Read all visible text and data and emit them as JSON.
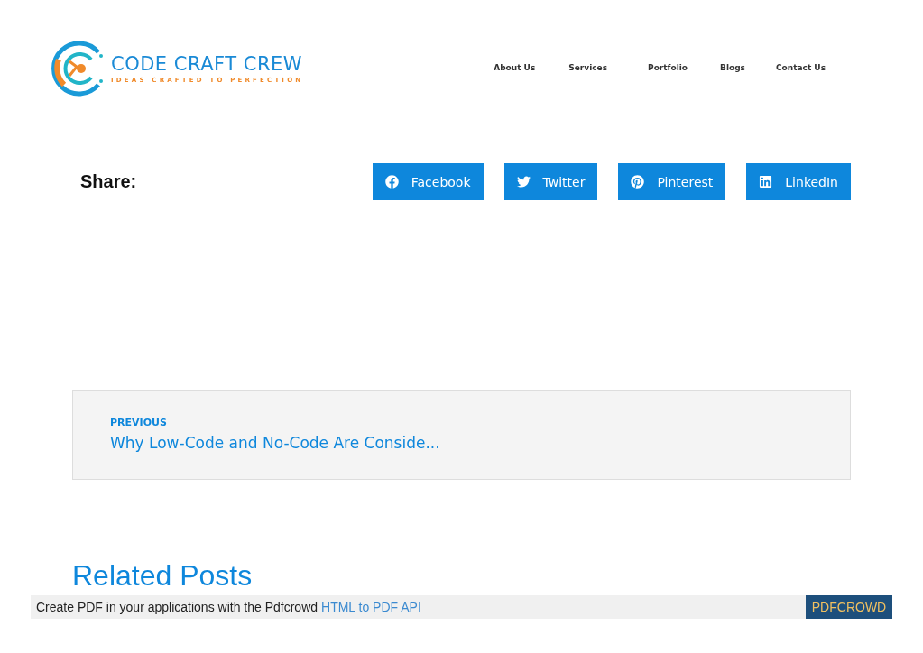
{
  "header": {
    "logo": {
      "name": "CODE CRAFT CREW",
      "tagline": "IDEAS CRAFTED TO PERFECTION"
    },
    "nav": [
      {
        "label": "About Us"
      },
      {
        "label": "Services"
      },
      {
        "label": "Portfolio"
      },
      {
        "label": "Blogs"
      },
      {
        "label": "Contact Us"
      }
    ]
  },
  "share": {
    "label": "Share:",
    "buttons": [
      {
        "kind": "facebook",
        "label": "Facebook"
      },
      {
        "kind": "twitter",
        "label": "Twitter"
      },
      {
        "kind": "pinterest",
        "label": "Pinterest"
      },
      {
        "kind": "linkedin",
        "label": "LinkedIn"
      }
    ]
  },
  "post_navigation": {
    "label": "PREVIOUS",
    "title": "Why Low-Code and No-Code Are Conside..."
  },
  "related": {
    "heading": "Related Posts"
  },
  "pdf_banner": {
    "text": "Create PDF in your applications with the Pdfcrowd",
    "link": "HTML to PDF API",
    "button": "PDFCROWD"
  }
}
